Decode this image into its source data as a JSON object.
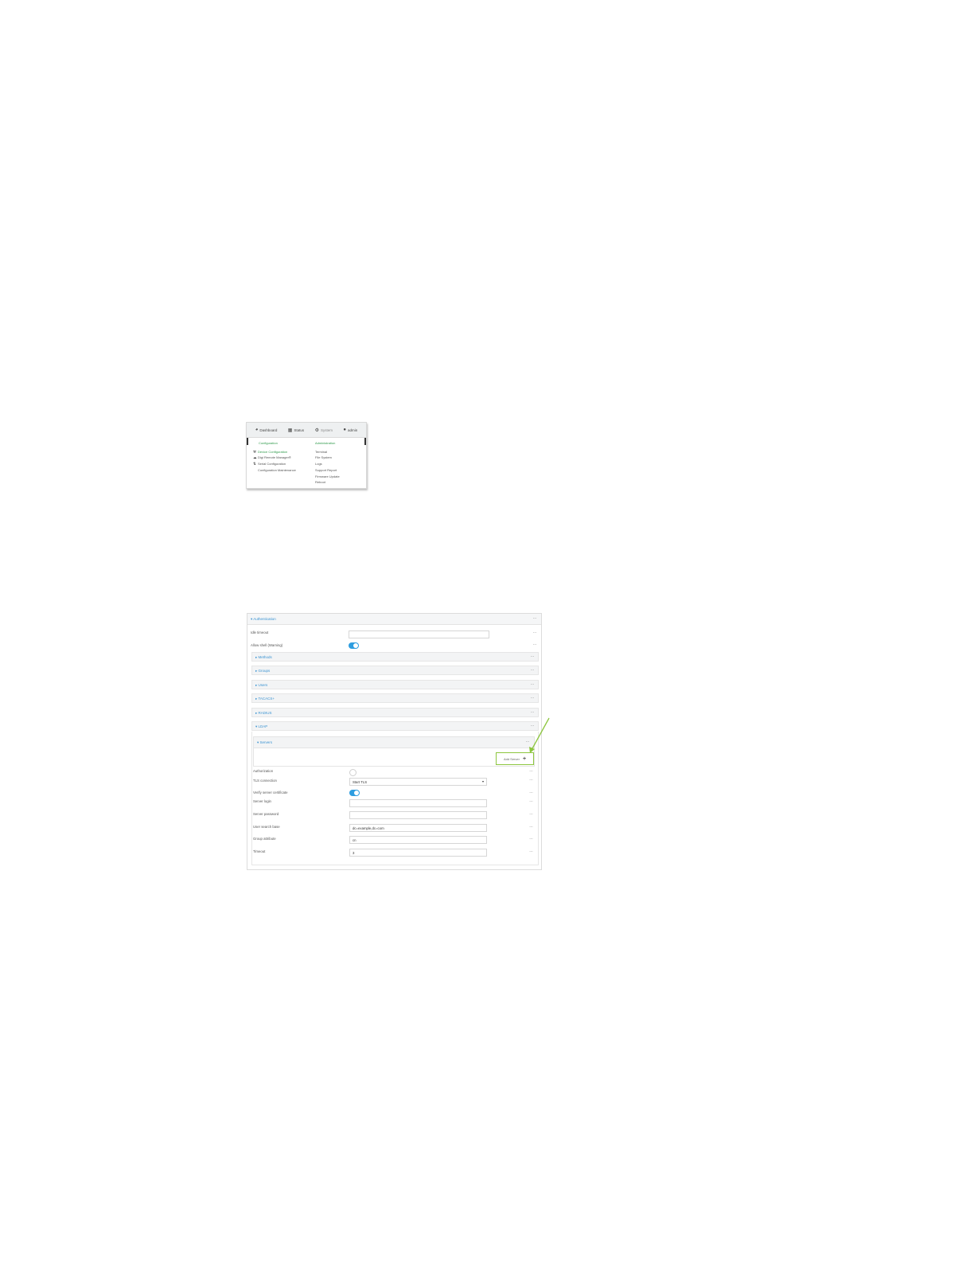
{
  "menu": {
    "nav": {
      "dashboard": "Dashboard",
      "status": "Status",
      "system": "System",
      "admin": "admin"
    },
    "configuration": {
      "heading": "Configuration",
      "items": [
        "Device Configuration",
        "Digi Remote Manager®",
        "Serial Configuration",
        "Configuration Maintenance"
      ]
    },
    "administration": {
      "heading": "Administration",
      "items": [
        "Terminal",
        "File System",
        "Logs",
        "Support Report",
        "Firmware Update",
        "Reboot"
      ]
    }
  },
  "auth": {
    "title": "Authentication",
    "idle_timeout_label": "Idle timeout",
    "idle_timeout_value": "",
    "allow_shell_label": "Allow shell (Warning)",
    "sections": [
      "Methods",
      "Groups",
      "Users",
      "TACACS+",
      "RADIUS"
    ],
    "ldap": {
      "title": "LDAP",
      "servers_title": "Servers",
      "add_server_label": "Add Server",
      "fields": {
        "authorization_label": "Authorization",
        "tls_label": "TLS connection",
        "tls_value": "Start TLS",
        "verify_label": "Verify server certificate",
        "login_label": "Server login",
        "login_value": "",
        "password_label": "Server password",
        "password_value": "",
        "user_base_label": "User search base",
        "user_base_value": "dc=example,dc=com",
        "group_attr_label": "Group attribute",
        "group_attr_value": "cn",
        "timeout_label": "Timeout",
        "timeout_value": "3"
      }
    }
  },
  "colors": {
    "accent_blue": "#3a93d2",
    "toggle_on": "#2d9de0",
    "menu_green": "#2e9a4a",
    "annotation_green": "#8dc63f"
  }
}
